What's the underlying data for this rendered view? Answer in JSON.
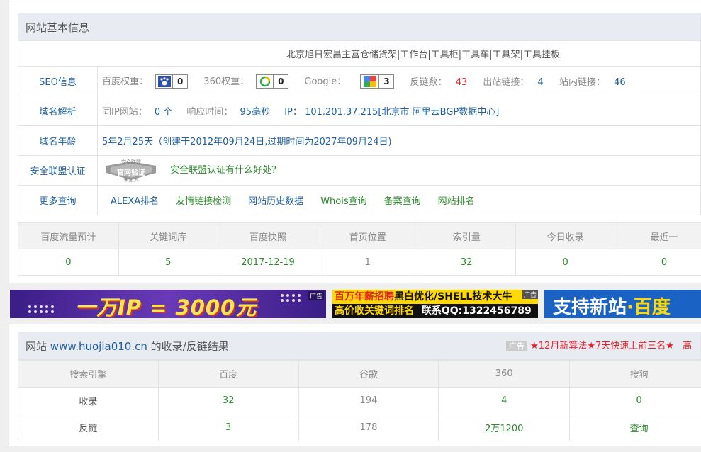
{
  "basic": {
    "title": "网站基本信息",
    "site_desc": "北京旭日宏昌主营仓储货架|工作台|工具柜|工具车|工具架|工具挂板",
    "seo": {
      "label": "SEO信息",
      "baidu_label": "百度权重：",
      "baidu_value": "0",
      "q360_label": "360权重：",
      "q360_value": "0",
      "google_label": "Google：",
      "google_value": "3",
      "backlinks_label": "反链数：",
      "backlinks_value": "43",
      "outlinks_label": "出站链接：",
      "outlinks_value": "4",
      "inlinks_label": "站内链接：",
      "inlinks_value": "46"
    },
    "dns": {
      "label": "域名解析",
      "sameip_label": "同IP网站：",
      "sameip_value": "0 个",
      "resp_label": "响应时间：",
      "resp_value": "95毫秒",
      "ip_label": "IP：",
      "ip_value": "101.201.37.215[北京市 阿里云BGP数据中心]"
    },
    "age": {
      "label": "域名年龄",
      "value": "5年2月25天（创建于2012年09月24日,过期时间为2027年09月24日)"
    },
    "security": {
      "label": "安全联盟认证",
      "badge_top": "安全联盟",
      "badge_main": "官网验证",
      "badge_sub": "未加入",
      "link": "安全联盟认证有什么好处？"
    },
    "more": {
      "label": "更多查询",
      "links": [
        "ALEXA排名",
        "友情链接检测",
        "网站历史数据",
        "Whois查询",
        "备案查询",
        "网站排名"
      ]
    }
  },
  "stats": {
    "headers": [
      "百度流量预计",
      "关键词库",
      "百度快照",
      "首页位置",
      "索引量",
      "今日收录",
      "最近一"
    ],
    "values": [
      "0",
      "5",
      "2017-12-19",
      "1",
      "32",
      "0",
      "0"
    ]
  },
  "ads": {
    "banner1_text": "一万IP = 3000元",
    "banner1_tag": "广告",
    "banner2_line1a": "百万年薪招聘",
    "banner2_line1b": "黑白优化/SHELL技术大牛",
    "banner2_line2a": "高价收关键词排名",
    "banner2_line2b": "联系QQ:1322456789",
    "banner2_tag": "广告",
    "banner3_a": "支持新站",
    "banner3_b": "·",
    "banner3_c": "百度"
  },
  "records": {
    "title_pre": "网站",
    "domain": "www.huojia010.cn",
    "title_post": "的收录/反链结果",
    "ad_tag": "广告",
    "ad_text": "★12月新算法★7天快速上前三名★",
    "ad_tail": "高",
    "headers": [
      "搜索引擎",
      "百度",
      "谷歌",
      "360",
      "搜狗"
    ],
    "rows": [
      [
        "收录",
        "32",
        "194",
        "4",
        "0"
      ],
      [
        "反链",
        "3",
        "178",
        "2万1200",
        "查询"
      ]
    ]
  },
  "colors": {
    "header_bg": "#e8ebf1",
    "link_blue": "#1f5f9f",
    "link_green": "#2c8a2c",
    "alert_red": "#e2232a",
    "banner_purple": "#4b2a9a",
    "banner_yellow": "#ffd800"
  }
}
